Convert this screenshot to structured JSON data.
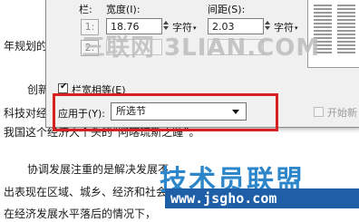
{
  "document": {
    "lines": [
      "年规划的",
      "创新",
      "科技对经",
      "我国这个经济大个头的“阿喀琉斯之踵”。",
      "协调发展注重的是解决发展不",
      "出表现在区域、城乡、经济和社会",
      "在经济发展水平落后的情况下，"
    ]
  },
  "dialog": {
    "col_label": "栏:",
    "width_label": "宽度(I):",
    "spacing_label": "间距(S):",
    "rows": [
      {
        "num": "1:",
        "width": "18.76",
        "width_unit": "字符",
        "spacing": "2.03",
        "spacing_unit": "字符"
      },
      {
        "num": "2:",
        "width": "",
        "width_unit": "",
        "spacing": "",
        "spacing_unit": ""
      }
    ],
    "equal_width_label": "栏宽相等(E)",
    "equal_width_checked": true,
    "apply_to_label": "应用于(Y):",
    "apply_to_value": "所选节",
    "new_column_label": "开始新",
    "new_column_checked": false
  },
  "watermarks": {
    "top": "三联网 3LIAN.COM",
    "bottom": "技术员联盟",
    "url": "www.jsgho.com"
  },
  "colors": {
    "highlight": "#d9201f"
  }
}
